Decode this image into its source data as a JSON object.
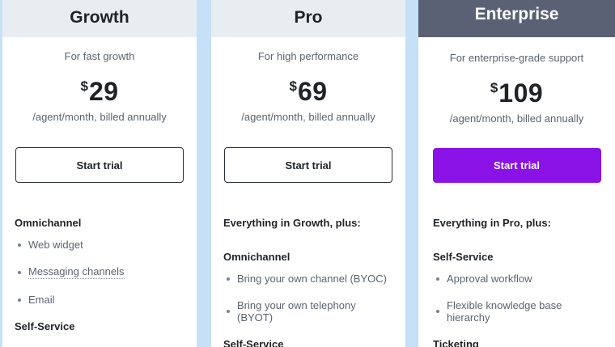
{
  "plans": [
    {
      "name": "Growth",
      "tagline": "For fast growth",
      "currency": "$",
      "price": "29",
      "billing": "/agent/month, billed annually",
      "cta": "Start trial",
      "intro": "",
      "sections": [
        {
          "heading": "Omnichannel",
          "items": [
            "Web widget",
            "Messaging channels",
            "Email"
          ]
        },
        {
          "heading": "Self-Service",
          "items": []
        }
      ]
    },
    {
      "name": "Pro",
      "tagline": "For high performance",
      "currency": "$",
      "price": "69",
      "billing": "/agent/month, billed annually",
      "cta": "Start trial",
      "intro": "Everything in Growth, plus:",
      "sections": [
        {
          "heading": "Omnichannel",
          "items": [
            "Bring your own channel (BYOC)",
            "Bring your own telephony (BYOT)"
          ]
        },
        {
          "heading": "Self-Service",
          "items": []
        }
      ]
    },
    {
      "name": "Enterprise",
      "tagline": "For enterprise-grade support",
      "currency": "$",
      "price": "109",
      "billing": "/agent/month, billed annually",
      "cta": "Start trial",
      "intro": "Everything in Pro, plus:",
      "sections": [
        {
          "heading": "Self-Service",
          "items": [
            "Approval workflow",
            "Flexible knowledge base hierarchy"
          ]
        },
        {
          "heading": "Ticketing",
          "items": []
        }
      ]
    }
  ],
  "colors": {
    "background": "#c6e0f7",
    "header_light": "#e8edf2",
    "header_enterprise": "#5a6175",
    "cta_enterprise": "#8a12e6"
  }
}
